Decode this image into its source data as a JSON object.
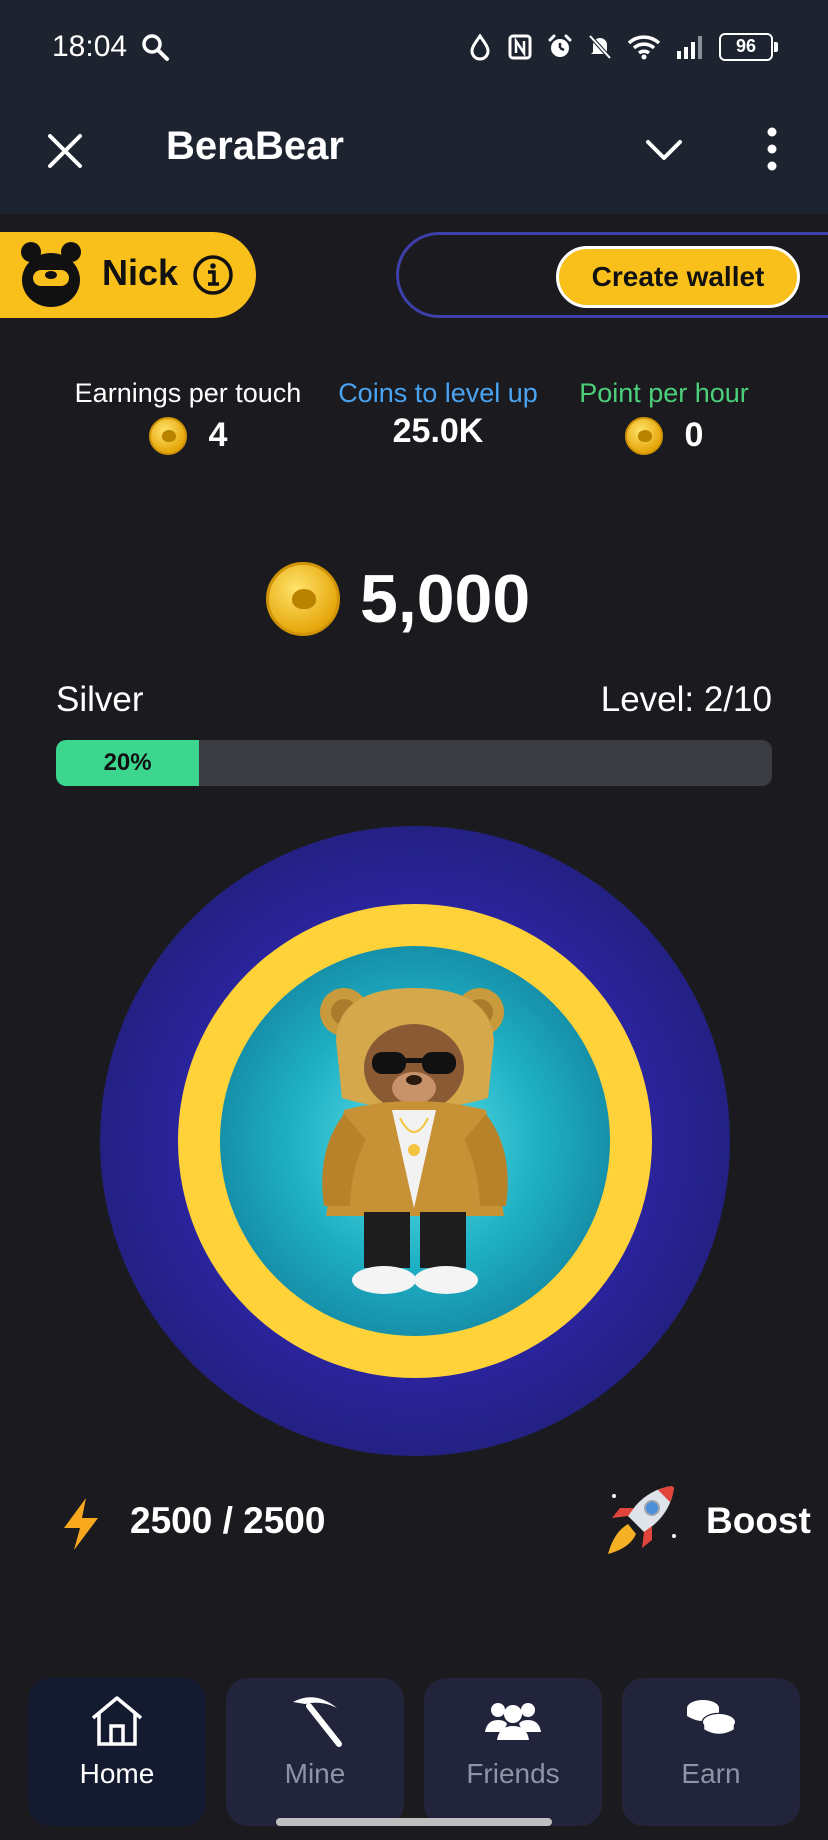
{
  "status_bar": {
    "time": "18:04",
    "battery": "96",
    "icons": [
      "search-icon",
      "drop-icon",
      "nfc-icon",
      "alarm-icon",
      "mute-icon",
      "wifi-icon",
      "signal-icon",
      "battery-icon"
    ]
  },
  "header": {
    "title": "BeraBear",
    "icons": [
      "close-icon",
      "chevron-down-icon",
      "more-vertical-icon"
    ]
  },
  "profile": {
    "name": "Nick",
    "icon": "bear-face-icon",
    "info_icon": "info-icon"
  },
  "wallet": {
    "button_label": "Create wallet"
  },
  "stats": {
    "earnings_per_touch": {
      "label": "Earnings per touch",
      "value": "4"
    },
    "coins_to_level_up": {
      "label": "Coins to level up",
      "value": "25.0K"
    },
    "point_per_hour": {
      "label": "Point per hour",
      "value": "0"
    }
  },
  "balance": {
    "value": "5,000",
    "icon": "coin-icon"
  },
  "level": {
    "tier": "Silver",
    "label": "Level: 2/10",
    "progress_text": "20%",
    "progress": 0.2
  },
  "energy": {
    "value": "2500 / 2500",
    "icon": "lightning-icon"
  },
  "boost": {
    "label": "Boost",
    "icon": "rocket-icon"
  },
  "nav": [
    {
      "label": "Home",
      "icon": "home-icon",
      "active": true
    },
    {
      "label": "Mine",
      "icon": "pickaxe-icon",
      "active": false
    },
    {
      "label": "Friends",
      "icon": "friends-icon",
      "active": false
    },
    {
      "label": "Earn",
      "icon": "coins-stack-icon",
      "active": false
    }
  ],
  "colors": {
    "accent_yellow": "#f9c01c",
    "progress_green": "#3dd68f",
    "level_blue": "#4aa3f0",
    "hour_green": "#4ccf7a",
    "background": "#1b1b1f"
  }
}
